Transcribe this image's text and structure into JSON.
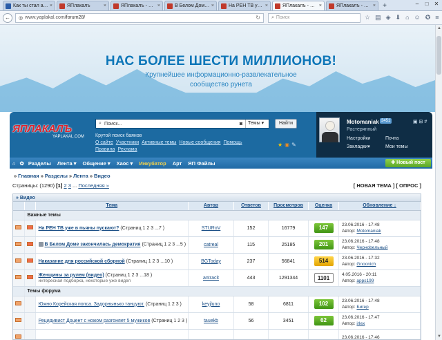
{
  "browser": {
    "tabs": [
      {
        "title": "Как ты стал атеистом"
      },
      {
        "title": "ЯПлакалъ"
      },
      {
        "title": "ЯПлакалъ - Разделы"
      },
      {
        "title": "В Белом Доме закон..."
      },
      {
        "title": "На РЕН ТВ уже в пья..."
      },
      {
        "title": "ЯПлакалъ - Раздел..."
      },
      {
        "title": "ЯПлакалъ - Раздел..."
      }
    ],
    "url_host": "www.yaplakal.com",
    "url_path": "/forum28/",
    "search_placeholder": "Поиск"
  },
  "banner": {
    "headline": "НАС БОЛЕЕ ШЕСТИ МИЛЛИОНОВ!",
    "sub_line1": "Крупнейшее информационно-развлекательное",
    "sub_line2": "сообщество рунета"
  },
  "header": {
    "logo_main": "ЯПЛАКАЛЪ",
    "logo_domain": "YAPLAKAL.COM",
    "search_placeholder": "Поиск...",
    "search_scope": "Темы",
    "find_button": "Найти",
    "caption": "Крутой поиск баянов",
    "links_row1": [
      "О сайте",
      "Участники",
      "Активные темы",
      "Новые сообщения",
      "Помощь"
    ],
    "links_row2": [
      "Правила",
      "Реклама"
    ]
  },
  "user": {
    "name": "Motomaniak",
    "badge": "3451",
    "rank": "Растерянный",
    "links": [
      "Настройки",
      "Почта",
      "Закладки",
      "Мои темы"
    ]
  },
  "menu": {
    "items": [
      "Разделы",
      "Лента",
      "Общение",
      "Хаос",
      "Инкубатор",
      "Арт",
      "ЯП Файлы"
    ],
    "new_post": "Новый пост"
  },
  "breadcrumb": [
    "Главная",
    "Разделы",
    "Лента",
    "Видео"
  ],
  "pagination": {
    "prefix": "Страницы:",
    "count": "(1290)",
    "current": "[1]",
    "pages": [
      "2",
      "3"
    ],
    "dots": "...",
    "last": "Последняя »"
  },
  "actions": "[ НОВАЯ ТЕМА ]   [ ОПРОС ]",
  "forum": {
    "section_title": "Видео",
    "columns": [
      "Тема",
      "Автор",
      "Ответов",
      "Просмотров",
      "Оценка",
      "Обновление ↓"
    ],
    "group_important": "Важные темы",
    "group_forum": "Темы форума",
    "important": [
      {
        "title": "На РЕН ТВ уже в пьяны пускают?",
        "pages": "(Страниц 1 2 3 ...7 )",
        "author": "STURoV",
        "replies": "152",
        "views": "16779",
        "rating": "147",
        "rating_style": "green",
        "updated": "23.06.2016 - 17:48",
        "last_author": "Motomaniak",
        "locked": false
      },
      {
        "title": "В Белом Доме закончилась демократия",
        "pages": "(Страниц 1 2 3 ...5 )",
        "author": "catreal",
        "replies": "115",
        "views": "25185",
        "rating": "201",
        "rating_style": "green",
        "updated": "23.06.2016 - 17:48",
        "last_author": "Черноbeльный",
        "locked": true
      },
      {
        "title": "Наказание для российской сборной",
        "pages": "(Страниц 1 2 3 ...10 )",
        "author": "BGToday",
        "replies": "237",
        "views": "56841",
        "rating": "514",
        "rating_style": "gold",
        "updated": "23.06.2016 - 17:32",
        "last_author": "Gnoonich",
        "locked": false
      },
      {
        "title": "Женщины за рулем (видео)",
        "pages": "(Страниц 1 2 3 ...18 )",
        "desc": "интересная подборка, некоторые уже видел",
        "author": "antracit",
        "replies": "443",
        "views": "1291344",
        "rating": "1101",
        "rating_style": "white",
        "updated": "4.05.2016 - 20:11",
        "last_author": "apps199",
        "locked": false
      }
    ],
    "topics": [
      {
        "title": "Южно Корейская попса. Задорнынько танцуют.",
        "pages": "(Страниц 1 2 3 )",
        "author": "keyjluno",
        "replies": "58",
        "views": "6811",
        "rating": "102",
        "rating_style": "green",
        "updated": "23.06.2016 - 17:48",
        "last_author": "Бигер"
      },
      {
        "title": "Рецидивист Доцент с ножом разгоняет 5 мужиков",
        "pages": "(Страниц 1 2 3 )",
        "author": "tauekb",
        "replies": "56",
        "views": "3451",
        "rating": "62",
        "rating_style": "green",
        "updated": "23.06.2016 - 17:47",
        "last_author": "irlex"
      },
      {
        "title": "",
        "pages": "",
        "author": "",
        "replies": "",
        "views": "",
        "rating": "",
        "rating_style": "green",
        "updated": "23.06.2016 - 17:46",
        "last_author": ""
      }
    ],
    "author_prefix": "Автор:"
  }
}
